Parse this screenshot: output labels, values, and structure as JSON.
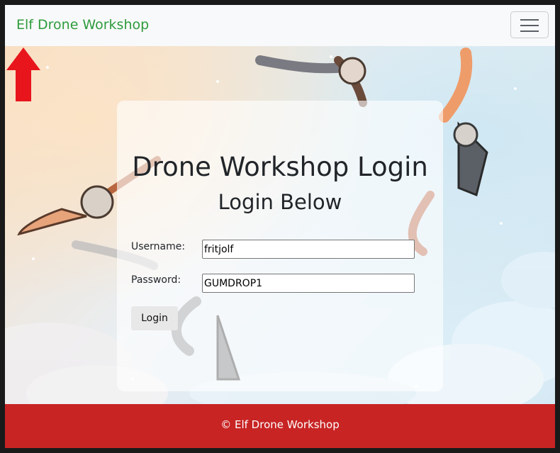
{
  "navbar": {
    "brand": "Elf Drone Workshop",
    "menu_icon": "hamburger-menu-icon"
  },
  "login": {
    "title": "Drone Workshop Login",
    "subtitle": "Login Below",
    "username_label": "Username:",
    "username_value": "fritjolf",
    "password_label": "Password:",
    "password_value": "GUMDROP1",
    "button_label": "Login"
  },
  "annotation": {
    "icon": "red-arrow-up-icon",
    "color": "#e8161c"
  },
  "footer": {
    "text": "© Elf Drone Workshop"
  },
  "colors": {
    "brand": "#2e9b3c",
    "footer": "#c82424",
    "navbar": "#f8f9fa"
  }
}
